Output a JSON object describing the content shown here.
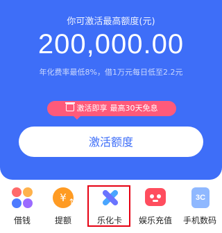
{
  "hero": {
    "subtitle": "你可激活最高额度(元)",
    "amount": "200,000.00",
    "rate_text": "年化费率最低8%，借1万元每日低至2.2元",
    "promo": {
      "left": "激活即享",
      "right": "最高30天免息"
    },
    "activate_button": "激活额度"
  },
  "nav": [
    {
      "label": "借钱",
      "icon": "flower-icon"
    },
    {
      "label": "提额",
      "icon": "yuan-up-icon"
    },
    {
      "label": "乐化卡",
      "icon": "x-card-icon",
      "highlighted": true
    },
    {
      "label": "娱乐充值",
      "icon": "tv-icon"
    },
    {
      "label": "手机数码",
      "icon": "phone-3c-icon",
      "icon_text": "3C"
    }
  ],
  "colors": {
    "primary": "#3e6ef8",
    "promo": "#ff5a7a",
    "highlight_border": "#e60012"
  }
}
